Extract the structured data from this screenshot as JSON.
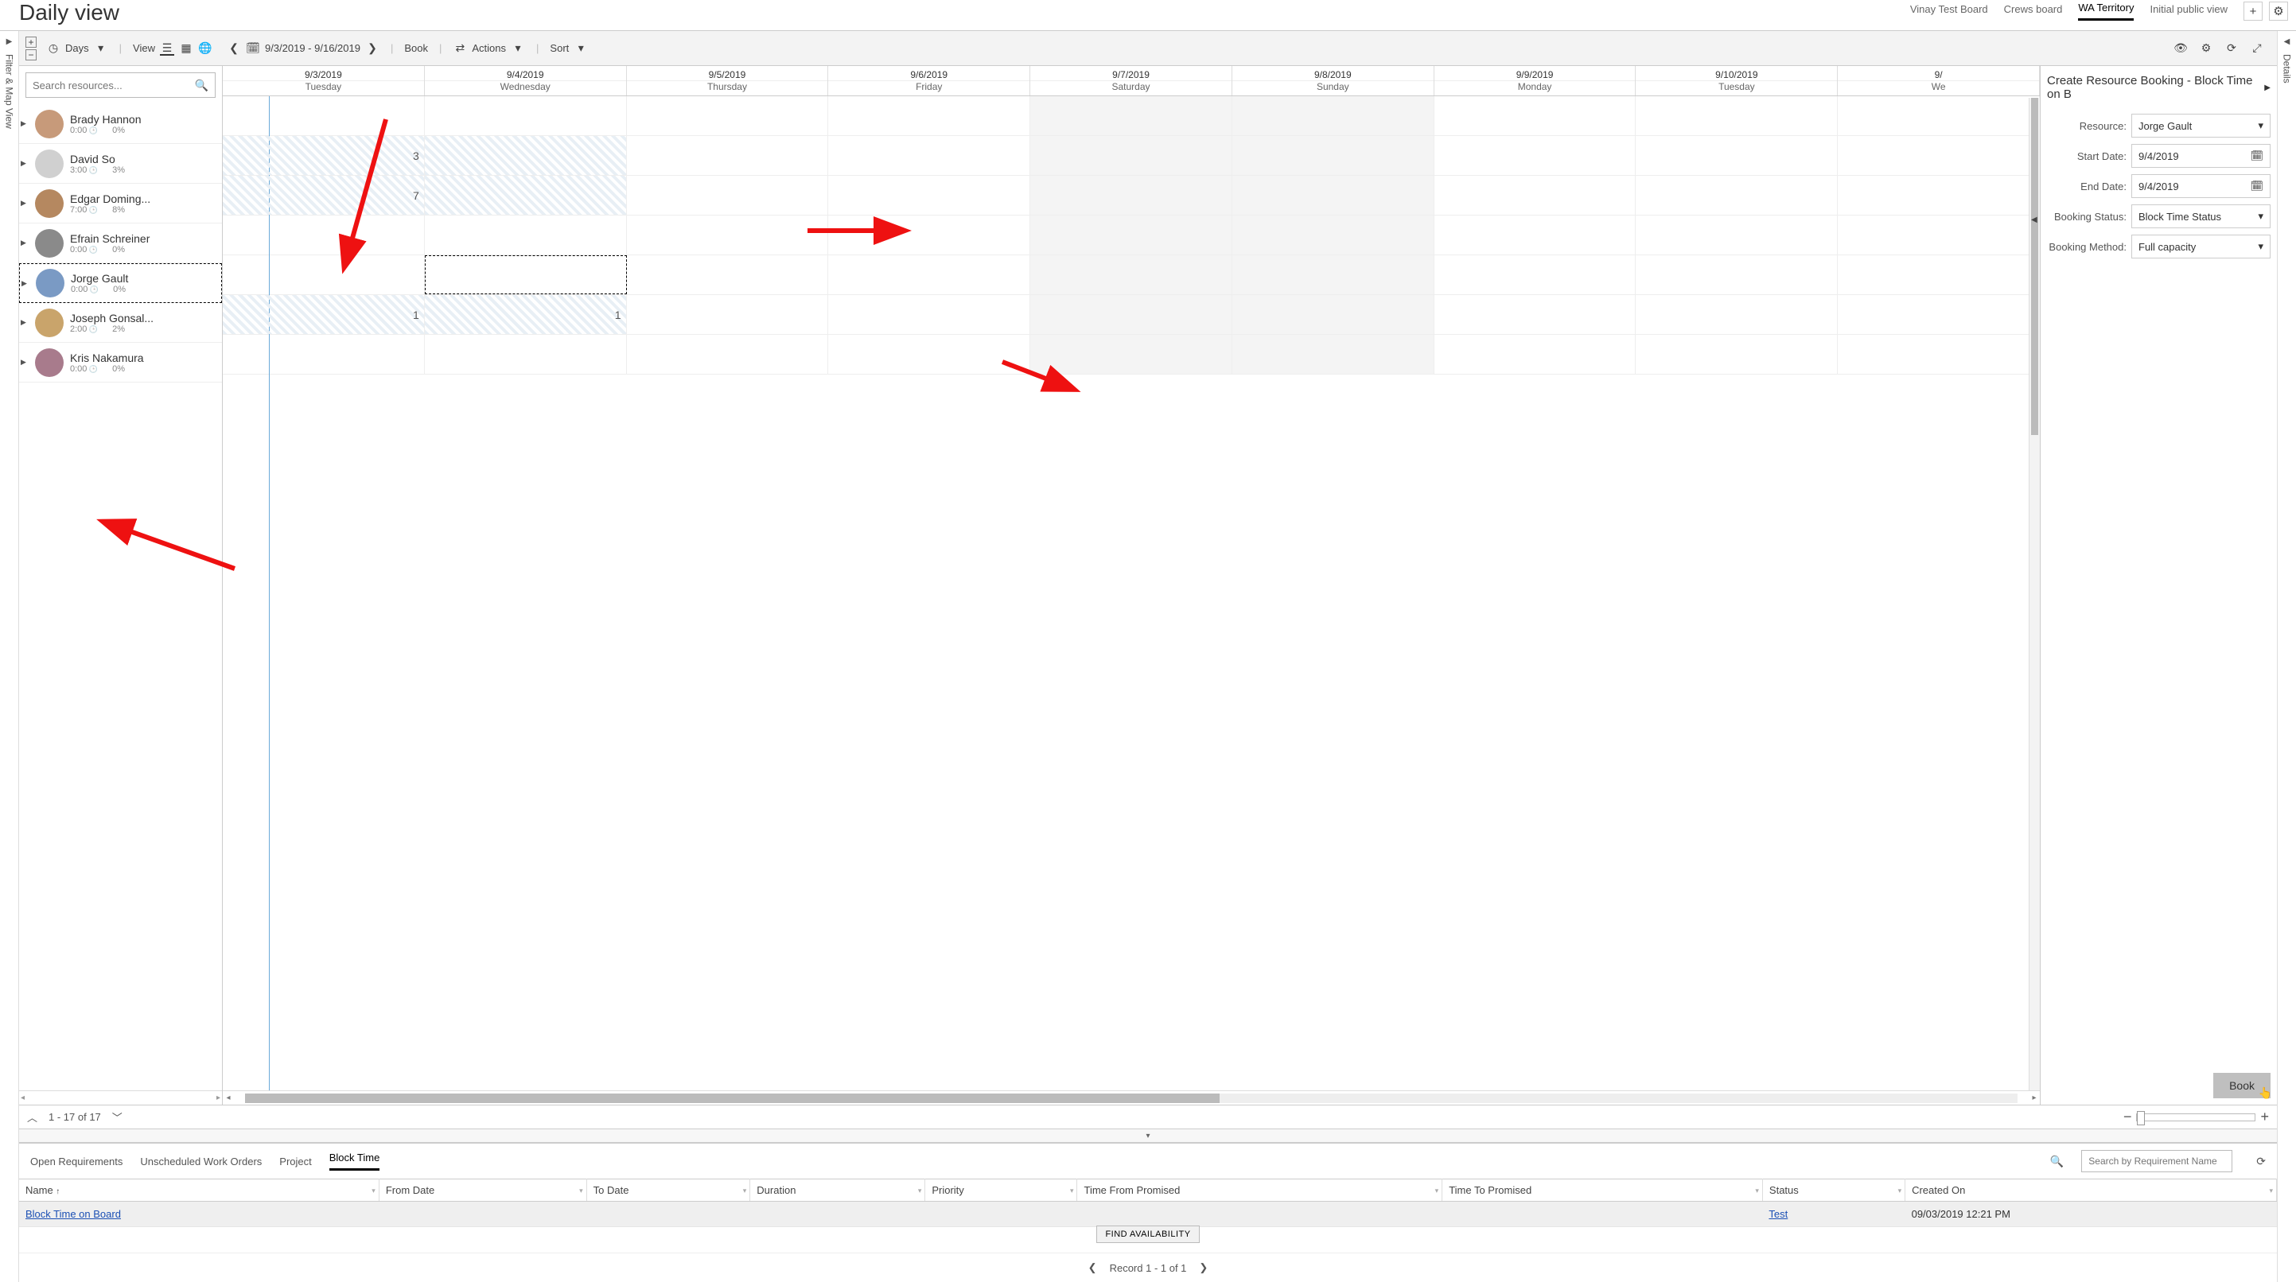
{
  "header": {
    "title": "Daily view",
    "boards": [
      "Vinay Test Board",
      "Crews board",
      "WA Territory",
      "Initial public view"
    ],
    "active_board_index": 2
  },
  "toolbar": {
    "scale_label": "Days",
    "view_label": "View",
    "date_range": "9/3/2019 - 9/16/2019",
    "book_label": "Book",
    "actions_label": "Actions",
    "sort_label": "Sort"
  },
  "search": {
    "placeholder": "Search resources..."
  },
  "columns": [
    {
      "date": "9/3/2019",
      "dow": "Tuesday"
    },
    {
      "date": "9/4/2019",
      "dow": "Wednesday"
    },
    {
      "date": "9/5/2019",
      "dow": "Thursday"
    },
    {
      "date": "9/6/2019",
      "dow": "Friday"
    },
    {
      "date": "9/7/2019",
      "dow": "Saturday"
    },
    {
      "date": "9/8/2019",
      "dow": "Sunday"
    },
    {
      "date": "9/9/2019",
      "dow": "Monday"
    },
    {
      "date": "9/10/2019",
      "dow": "Tuesday"
    },
    {
      "date": "9/",
      "dow": "We"
    }
  ],
  "resources": [
    {
      "name": "Brady Hannon",
      "hrs": "0:00",
      "pct": "0%",
      "avatar": "#c79a7a"
    },
    {
      "name": "David So",
      "hrs": "3:00",
      "pct": "3%",
      "avatar": "#d0d0d0"
    },
    {
      "name": "Edgar Doming...",
      "hrs": "7:00",
      "pct": "8%",
      "avatar": "#b58860"
    },
    {
      "name": "Efrain Schreiner",
      "hrs": "0:00",
      "pct": "0%",
      "avatar": "#8a8a8a"
    },
    {
      "name": "Jorge Gault",
      "hrs": "0:00",
      "pct": "0%",
      "avatar": "#7a9ac4",
      "selected": true
    },
    {
      "name": "Joseph Gonsal...",
      "hrs": "2:00",
      "pct": "2%",
      "avatar": "#c9a46b"
    },
    {
      "name": "Kris Nakamura",
      "hrs": "0:00",
      "pct": "0%",
      "avatar": "#a87b8c"
    }
  ],
  "cells": {
    "1": {
      "0": "3"
    },
    "2": {
      "0": "7"
    },
    "5": {
      "0": "1",
      "1": "1"
    }
  },
  "hatched_rows": [
    1,
    2,
    5
  ],
  "weekend_cols": [
    4,
    5
  ],
  "panel": {
    "title": "Create Resource Booking - Block Time on B",
    "fields": {
      "resource_label": "Resource:",
      "resource_value": "Jorge Gault",
      "start_label": "Start Date:",
      "start_value": "9/4/2019",
      "end_label": "End Date:",
      "end_value": "9/4/2019",
      "status_label": "Booking Status:",
      "status_value": "Block Time Status",
      "method_label": "Booking Method:",
      "method_value": "Full capacity"
    },
    "book_button": "Book"
  },
  "footer": {
    "range": "1 - 17 of 17"
  },
  "side_rails": {
    "left": "Filter & Map View",
    "right": "Details"
  },
  "req": {
    "tabs": [
      "Open Requirements",
      "Unscheduled Work Orders",
      "Project",
      "Block Time"
    ],
    "active_tab_index": 3,
    "search_placeholder": "Search by Requirement Name",
    "columns": [
      "Name",
      "From Date",
      "To Date",
      "Duration",
      "Priority",
      "Time From Promised",
      "Time To Promised",
      "Status",
      "Created On"
    ],
    "sort_col": 0,
    "row": {
      "name": "Block Time on Board",
      "status": "Test",
      "created": "09/03/2019 12:21 PM"
    },
    "find_label": "FIND AVAILABILITY",
    "record_label": "Record 1 - 1 of 1"
  }
}
